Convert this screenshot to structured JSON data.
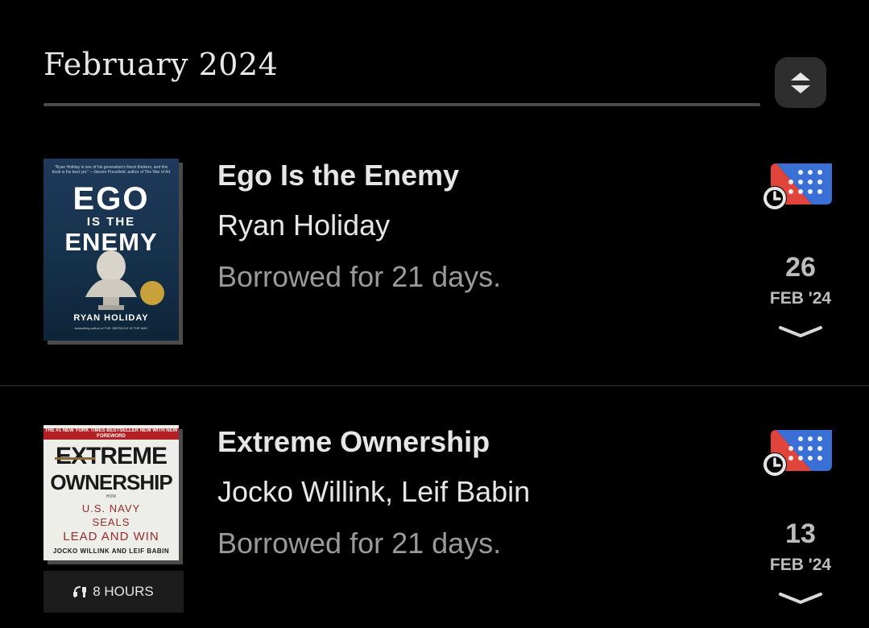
{
  "header": {
    "month_title": "February 2024",
    "sort_icon": "sort-updown-icon"
  },
  "books": [
    {
      "title": "Ego Is the Enemy",
      "author": "Ryan Holiday",
      "status": "Borrowed for 21 days.",
      "due_day": "26",
      "due_month": "FEB '24",
      "cover": {
        "top_blurb": "\"Ryan Holiday is one of his generation's finest thinkers, and this book is his best yet.\" —Steven Pressfield, author of The War of Art",
        "line1": "EGO",
        "line2": "IS THE",
        "line3": "ENEMY",
        "author": "RYAN HOLIDAY",
        "bottom": "bestselling author of THE OBSTACLE IS THE WAY"
      }
    },
    {
      "title": "Extreme Ownership",
      "author": "Jocko Willink, Leif Babin",
      "status": "Borrowed for 21 days.",
      "due_day": "13",
      "due_month": "FEB '24",
      "audio_label": "8 HOURS",
      "cover": {
        "banner": "THE #1 NEW YORK TIMES BESTSELLER\nNEW WITH NEW FOREWORD",
        "line1": "EXTREME",
        "line2": "OWNERSHIP",
        "how": "HOW",
        "line3": "U.S. NAVY",
        "line4": "SEALS",
        "line5": "LEAD AND WIN",
        "author": "JOCKO WILLINK AND LEIF BABIN"
      }
    }
  ],
  "colors": {
    "background": "#000000",
    "loan_icon_red": "#e0443a",
    "loan_icon_blue": "#3a6fd6"
  }
}
